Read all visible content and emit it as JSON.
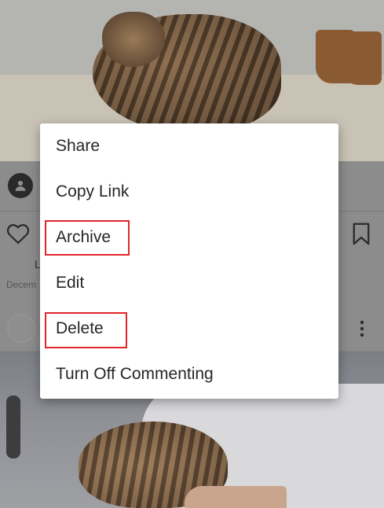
{
  "menu": {
    "items": [
      {
        "label": "Share"
      },
      {
        "label": "Copy Link"
      },
      {
        "label": "Archive"
      },
      {
        "label": "Edit"
      },
      {
        "label": "Delete"
      },
      {
        "label": "Turn Off Commenting"
      }
    ],
    "highlighted": [
      "Archive",
      "Delete"
    ],
    "highlight_color": "#e0262b"
  },
  "post": {
    "likes_fragment": "L",
    "date_fragment": "Decem"
  },
  "icons": [
    "avatar-icon",
    "heart-icon",
    "bookmark-icon",
    "more-icon"
  ]
}
